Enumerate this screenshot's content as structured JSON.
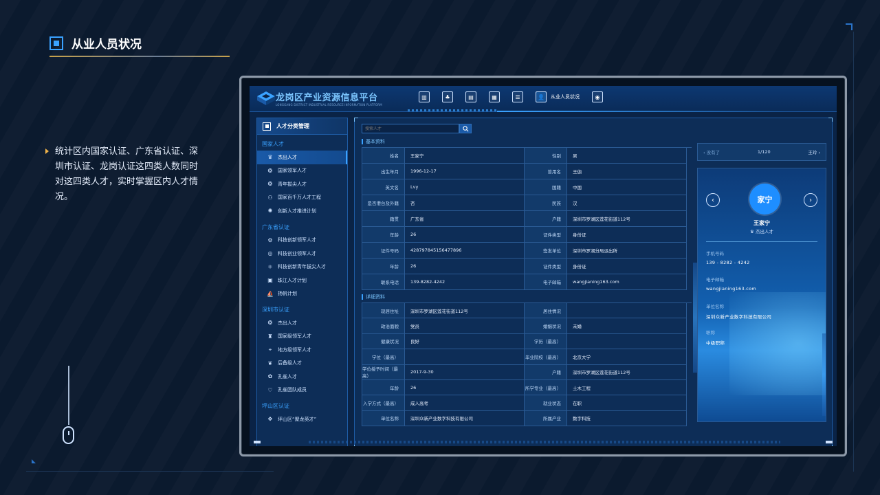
{
  "slide": {
    "title": "从业人员状况",
    "description": "统计区内国家认证、广东省认证、深圳市认证、龙岗认证这四类人数同时对这四类人才，实时掌握区内人才情况。"
  },
  "app": {
    "title": "龙岗区产业资源信息平台",
    "subtitle": "LONGGANG DISTRICT INDUSTRIAL RESOURCE INFORMATION PLATFORM",
    "nav_active_label": "从业人员状况"
  },
  "sidebar": {
    "header": "人才分类管理",
    "groups": [
      {
        "label": "国家人才",
        "items": [
          "杰出人才",
          "国家领军人才",
          "青年拔尖人才",
          "国家百千万人才工程",
          "创新人才推进计划"
        ]
      },
      {
        "label": "广东省认证",
        "items": [
          "科技创新领军人才",
          "科技创业领军人才",
          "科技创新青年拔尖人才",
          "珠江人才计划",
          "扬帆计划"
        ]
      },
      {
        "label": "深圳市认证",
        "items": [
          "杰出人才",
          "国家级领军人才",
          "地方级领军人才",
          "后备级人才",
          "孔雀人才",
          "孔雀团队成员"
        ]
      },
      {
        "label": "坪山区认证",
        "items": [
          "坪山区“聚龙英才”"
        ]
      }
    ]
  },
  "search": {
    "placeholder": "搜索人才"
  },
  "basic": {
    "title": "基本资料",
    "rows": [
      [
        "姓名",
        "王家宁",
        "性别",
        "男"
      ],
      [
        "出生年月",
        "1996-12-17",
        "曾用名",
        "王伽"
      ],
      [
        "英文名",
        "Lvy",
        "国籍",
        "中国"
      ],
      [
        "是否港台及外籍",
        "否",
        "民族",
        "汉"
      ],
      [
        "籍贯",
        "广东省",
        "户籍",
        "深圳市罗湖区莲花街道112号"
      ],
      [
        "年龄",
        "26",
        "证件类型",
        "身份证"
      ],
      [
        "证件号码",
        "428797845156477896",
        "签发单位",
        "深圳市罗湖分局派出所"
      ],
      [
        "年龄",
        "26",
        "证件类型",
        "身份证"
      ],
      [
        "联系电话",
        "139-8282-4242",
        "电子邮箱",
        "wangjianing163.com"
      ]
    ]
  },
  "detail": {
    "title": "详细资料",
    "rows": [
      [
        "现居住址",
        "深圳市罗湖区莲花街道112号",
        "居住情况",
        ""
      ],
      [
        "政治面貌",
        "党员",
        "婚姻状况",
        "未婚"
      ],
      [
        "健康状况",
        "良好",
        "学历（最高）",
        ""
      ],
      [
        "学位（最高）",
        "",
        "毕业院校（最高）",
        "北京大学"
      ],
      [
        "学位授予时间（最高）",
        "2017-9-30",
        "户籍",
        "深圳市罗湖区莲花街道112号"
      ],
      [
        "年龄",
        "26",
        "所学专业（最高）",
        "土木工程"
      ],
      [
        "入学方式（最高）",
        "成人高考",
        "就业状态",
        "在职"
      ],
      [
        "单位名称",
        "深圳众新产业数字科技有限公司",
        "所属产业",
        "数字科技"
      ]
    ]
  },
  "pager": {
    "prev": "没有了",
    "page": "1/120",
    "next": "王玲"
  },
  "profile": {
    "avatar_text": "家宁",
    "name": "王家宁",
    "title": "杰出人才",
    "phone_label": "手机号码",
    "phone": "139 - 8282 - 4242",
    "email_label": "电子邮箱",
    "email": "wangjianing163.com",
    "company_label": "单位名称",
    "company": "深圳众新产业数字科技有限公司",
    "rank_label": "职称",
    "rank": "中级职称"
  },
  "colors": {
    "accent": "#3aa2ff",
    "panel": "#0d2d57",
    "background": "#0b1a2e"
  }
}
